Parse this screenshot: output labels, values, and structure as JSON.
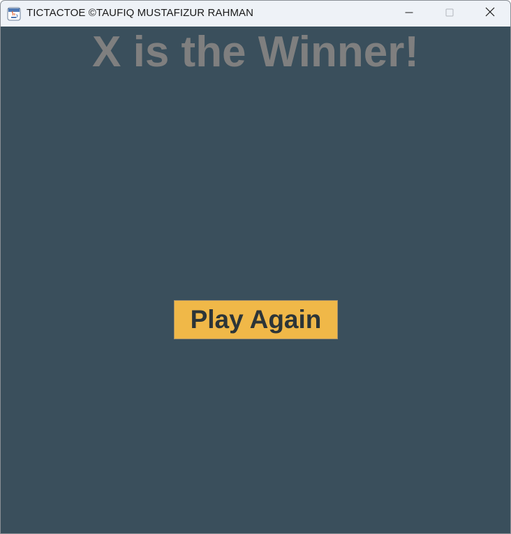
{
  "window": {
    "title": "TICTACTOE ©TAUFIQ MUSTAFIZUR RAHMAN",
    "app_icon": "java-icon",
    "controls": [
      "minimize-icon",
      "maximize-icon",
      "close-icon"
    ]
  },
  "game": {
    "status_message": "X is the Winner!",
    "play_again_label": "Play Again"
  },
  "colors": {
    "background": "#3a4f5c",
    "status_text": "#7f7f7f",
    "button_bg": "#f0b848",
    "button_text": "#2c3538",
    "titlebar": "#eef2f7"
  }
}
